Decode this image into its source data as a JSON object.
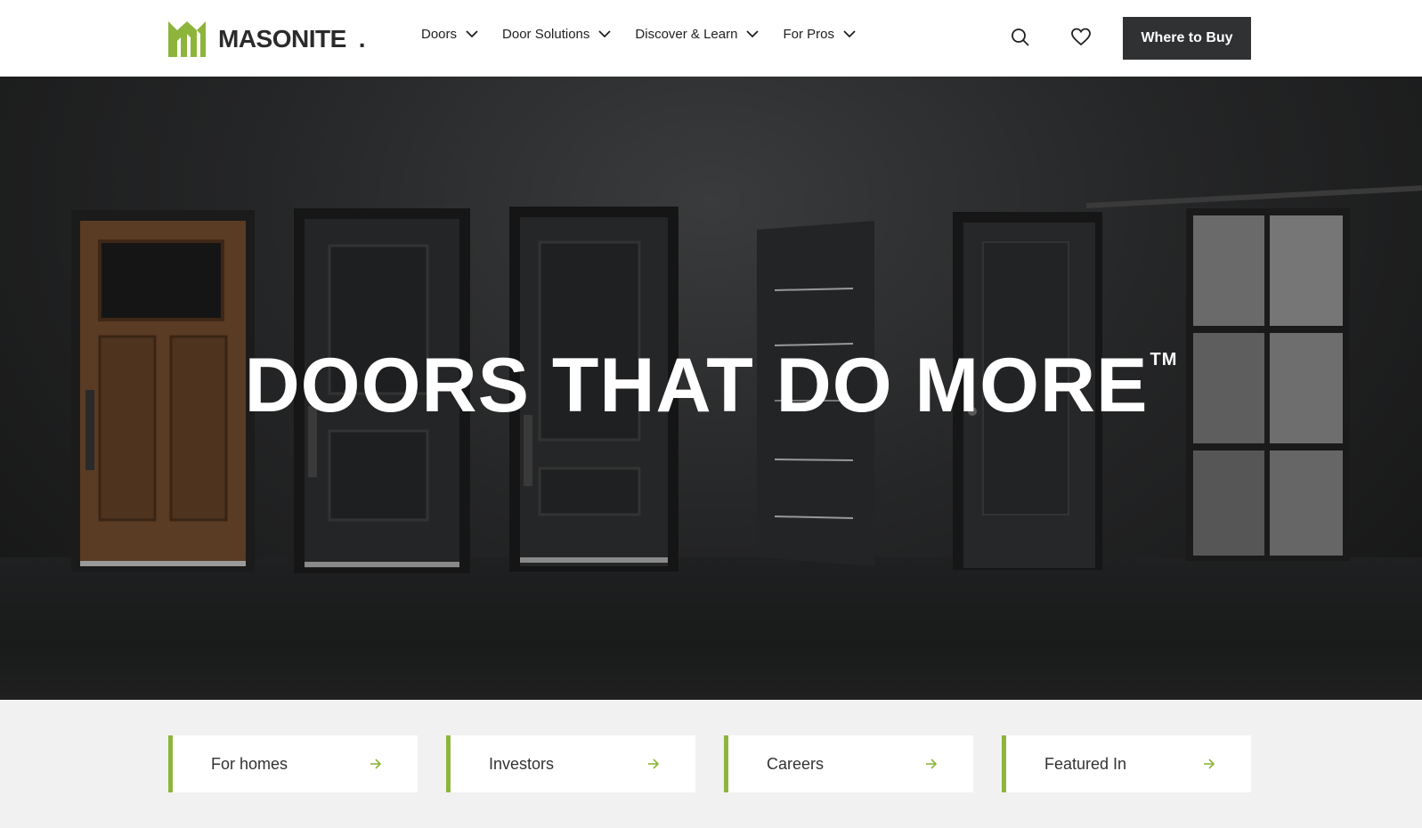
{
  "header": {
    "logo_text": "MASONITE",
    "nav": [
      {
        "label": "Doors"
      },
      {
        "label": "Door Solutions"
      },
      {
        "label": "Discover & Learn"
      },
      {
        "label": "For Pros"
      }
    ],
    "cta_label": "Where to Buy"
  },
  "hero": {
    "title": "DOORS THAT DO MORE",
    "trademark": "TM"
  },
  "cards": [
    {
      "label": "For homes"
    },
    {
      "label": "Investors"
    },
    {
      "label": "Careers"
    },
    {
      "label": "Featured In"
    }
  ],
  "colors": {
    "accent": "#8db53c",
    "cta_bg": "#2f3133",
    "hero_bg": "#252627"
  },
  "icons": [
    "logo-m-icon",
    "chevron-down-icon",
    "search-icon",
    "heart-icon",
    "arrow-right-icon"
  ]
}
